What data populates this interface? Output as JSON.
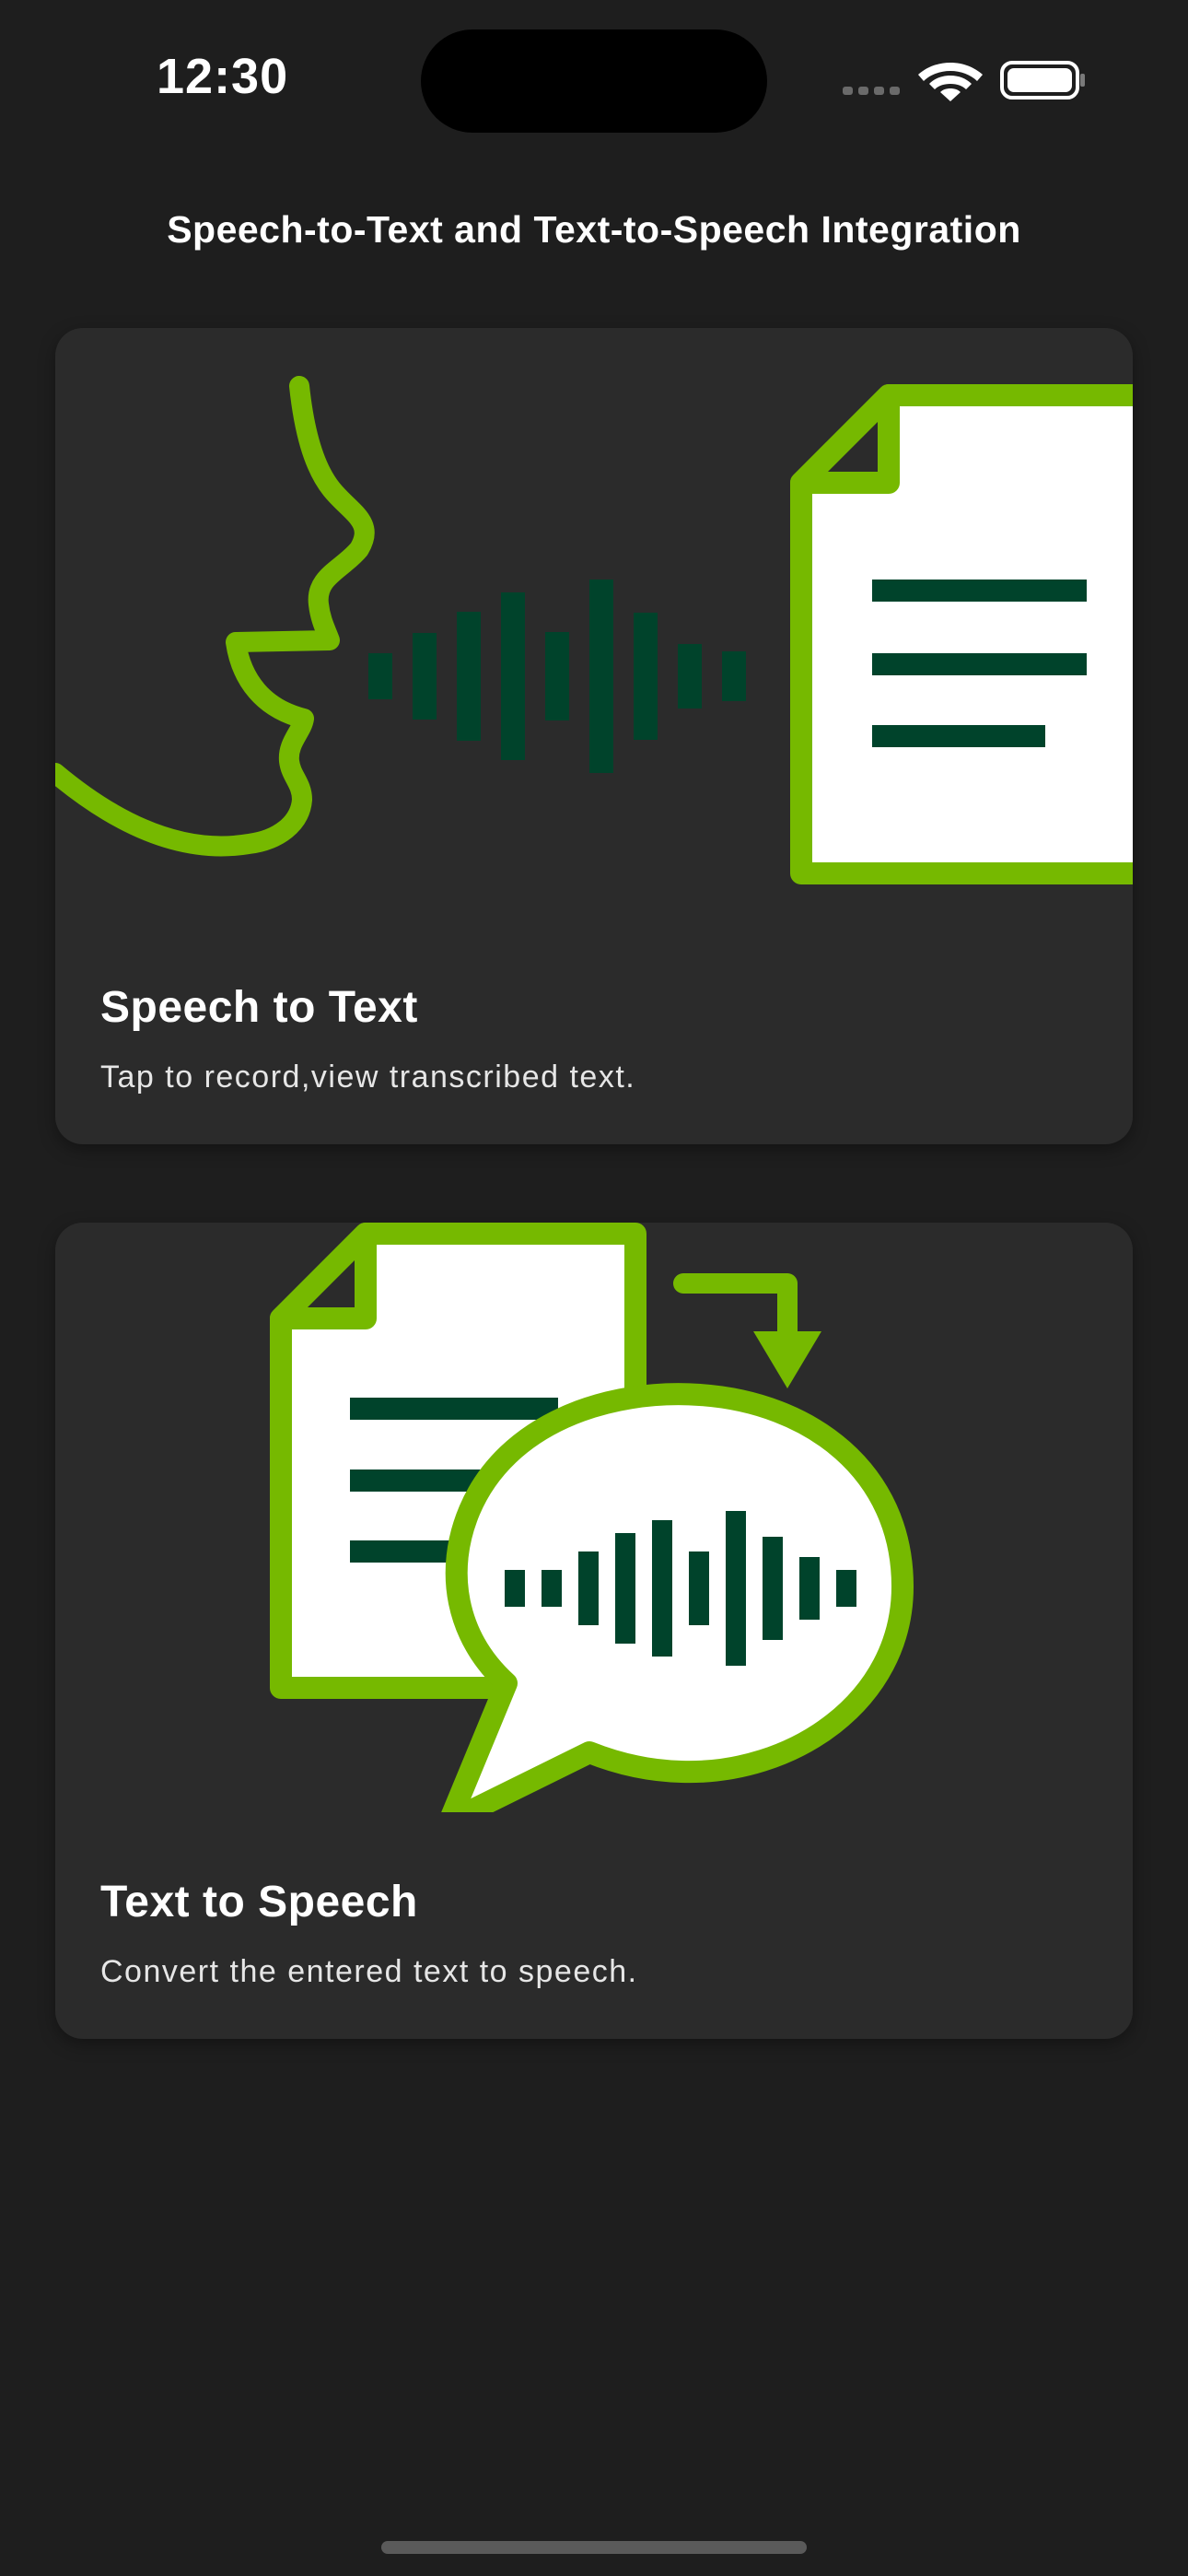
{
  "status_bar": {
    "time": "12:30",
    "icons": [
      "signal-dots-icon",
      "wifi-icon",
      "battery-icon"
    ]
  },
  "page": {
    "title": "Speech-to-Text and Text-to-Speech Integration"
  },
  "cards": [
    {
      "title": "Speech to Text",
      "subtitle": "Tap to record,view transcribed text.",
      "illustration": "speech-to-text-illustration"
    },
    {
      "title": "Text to Speech",
      "subtitle": "Convert the entered text to speech.",
      "illustration": "text-to-speech-illustration"
    }
  ],
  "colors": {
    "background": "#1e1e1e",
    "card": "#2b2b2b",
    "accent_green": "#76b900",
    "dark_green": "#00432b",
    "paper": "#ffffff"
  }
}
